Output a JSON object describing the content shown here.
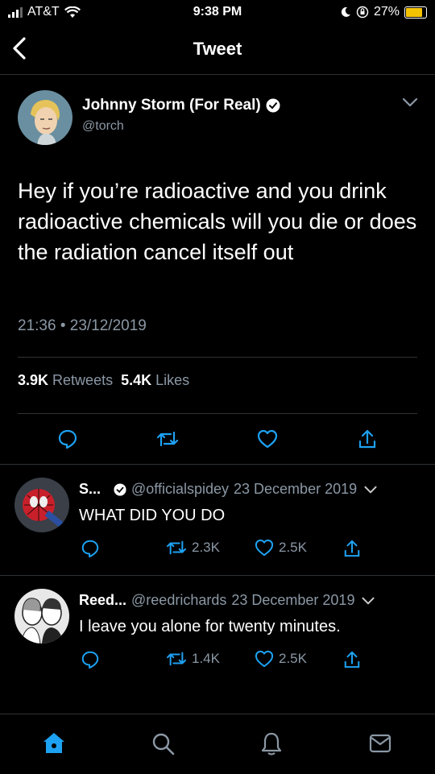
{
  "status_bar": {
    "carrier": "AT&T",
    "time": "9:38 PM",
    "battery": "27%"
  },
  "nav": {
    "title": "Tweet"
  },
  "tweet": {
    "author_name": "Johnny Storm (For Real)",
    "handle": "@torch",
    "text": "Hey if you’re radioactive and you drink radioactive chemicals will you die or does the radiation cancel itself out",
    "timestamp": "21:36 • 23/12/2019",
    "retweets_count": "3.9K",
    "retweets_label": "Retweets",
    "likes_count": "5.4K",
    "likes_label": "Likes"
  },
  "replies": [
    {
      "name": "S...",
      "handle": "@officialspidey",
      "date": "23 December 2019",
      "text": "WHAT DID YOU DO",
      "retweets": "2.3K",
      "likes": "2.5K"
    },
    {
      "name": "Reed...",
      "handle": "@reedrichards",
      "date": "23 December 2019",
      "text": "I leave you alone for twenty minutes.",
      "retweets": "1.4K",
      "likes": "2.5K"
    }
  ],
  "colors": {
    "accent": "#1da1f2",
    "muted": "#8b98a5",
    "divider": "#2f3336"
  },
  "icons": [
    "back-icon",
    "verified-icon",
    "chevron-down-icon",
    "reply-icon",
    "retweet-icon",
    "like-icon",
    "share-icon",
    "home-icon",
    "search-icon",
    "notifications-icon",
    "messages-icon"
  ]
}
